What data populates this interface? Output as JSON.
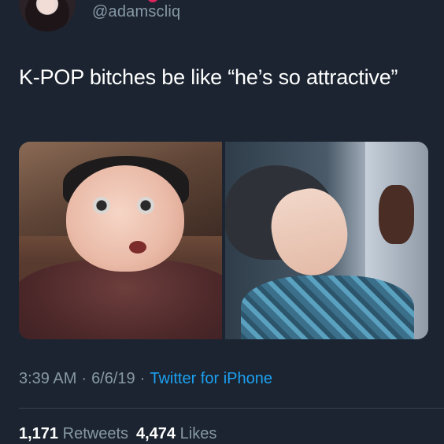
{
  "tweet": {
    "handle": "@adamscliq",
    "text": "K-POP bitches be like “he’s so attractive”",
    "time": "3:39 AM",
    "separator": "·",
    "date": "6/6/19",
    "source": "Twitter for iPhone",
    "retweets_count": "1,171",
    "retweets_label": "Retweets",
    "likes_count": "4,474",
    "likes_label": "Likes"
  },
  "colors": {
    "background": "#1b2430",
    "secondary_text": "#8899a6",
    "link": "#1da1f2",
    "divider": "#38444d"
  },
  "icons": {
    "avatar": "avatar-icon"
  }
}
